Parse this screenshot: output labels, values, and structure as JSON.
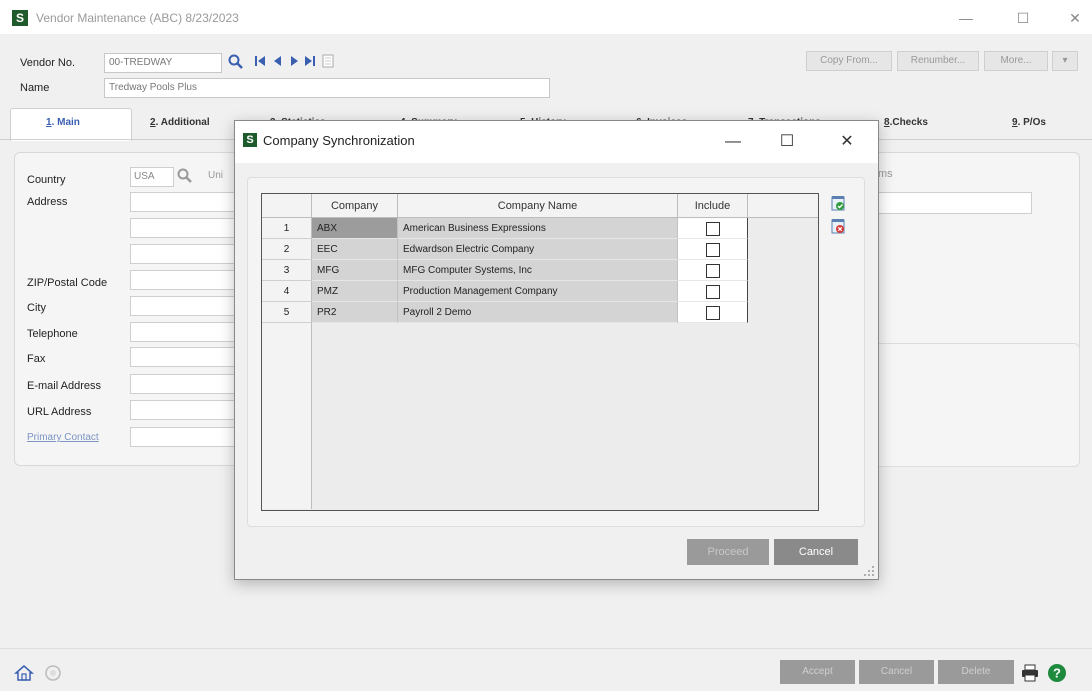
{
  "window": {
    "title": "Vendor Maintenance (ABC) 8/23/2023",
    "app_icon": "S",
    "minimize": "—",
    "maximize": "☐",
    "close": "✕"
  },
  "header": {
    "vendor_no_label": "Vendor No.",
    "vendor_no_value": "00-TREDWAY",
    "name_label": "Name",
    "name_value": "Tredway Pools Plus",
    "copy_from": "Copy From...",
    "renumber": "Renumber...",
    "more": "More...",
    "more_arrow": "▾"
  },
  "tabs": [
    {
      "num": "1",
      "label": ". Main"
    },
    {
      "num": "2",
      "label": ". Additional"
    },
    {
      "num": "3",
      "label": ". Statistics"
    },
    {
      "num": "4",
      "label": ". Summary"
    },
    {
      "num": "5",
      "label": ". History"
    },
    {
      "num": "6",
      "label": ". Invoices"
    },
    {
      "num": "7",
      "label": ". Transactions"
    },
    {
      "num": "8",
      "label": ".Checks"
    },
    {
      "num": "9",
      "label": ". P/Os"
    }
  ],
  "form": {
    "country_label": "Country",
    "country_value": "USA",
    "country_desc": "Uni",
    "address_label": "Address",
    "zip_label": "ZIP/Postal Code",
    "city_label": "City",
    "telephone_label": "Telephone",
    "fax_label": "Fax",
    "email_label": "E-mail Address",
    "url_label": "URL Address",
    "primary_contact_label": "Primary Contact",
    "right_field_fragment": "ms"
  },
  "footer": {
    "accept": "Accept",
    "cancel": "Cancel",
    "delete": "Delete"
  },
  "dialog": {
    "title": "Company Synchronization",
    "app_icon": "S",
    "minimize": "—",
    "maximize": "☐",
    "close": "✕",
    "columns": [
      "Company",
      "Company Name",
      "Include"
    ],
    "rows": [
      {
        "num": "1",
        "code": "ABX",
        "name": "American Business Expressions",
        "include": false
      },
      {
        "num": "2",
        "code": "EEC",
        "name": "Edwardson Electric Company",
        "include": false
      },
      {
        "num": "3",
        "code": "MFG",
        "name": "MFG Computer Systems, Inc",
        "include": false
      },
      {
        "num": "4",
        "code": "PMZ",
        "name": "Production Management Company",
        "include": false
      },
      {
        "num": "5",
        "code": "PR2",
        "name": "Payroll 2 Demo",
        "include": false
      }
    ],
    "proceed": "Proceed",
    "cancel": "Cancel"
  },
  "colors": {
    "brand_green": "#1f5a2c",
    "nav_blue": "#3a5fb0",
    "selected_cell": "#9c9c9c",
    "disabled_button": "#9a9a9a"
  }
}
